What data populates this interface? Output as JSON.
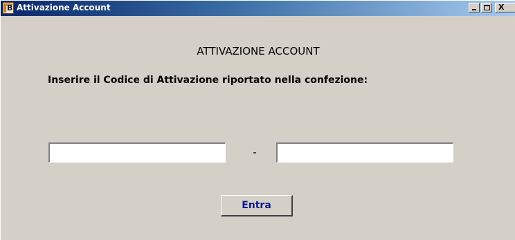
{
  "window": {
    "title": "Attivazione Account",
    "icon": "app-b-icon",
    "icon_glyph": "B",
    "controls": {
      "minimize_icon": "minimize-icon",
      "maximize_icon": "maximize-icon",
      "close_icon": "close-icon",
      "close_glyph": "X"
    }
  },
  "form": {
    "heading": "ATTIVAZIONE ACCOUNT",
    "instruction": "Inserire il Codice di Attivazione riportato nella confezione:",
    "code_part_1": {
      "value": "",
      "placeholder": ""
    },
    "separator": "-",
    "code_part_2": {
      "value": "",
      "placeholder": ""
    },
    "submit_label": "Entra"
  },
  "colors": {
    "titlebar_start": "#0a246a",
    "titlebar_end": "#a6caf0",
    "window_background": "#d4d0c8",
    "button_text": "#0a1a8a"
  }
}
